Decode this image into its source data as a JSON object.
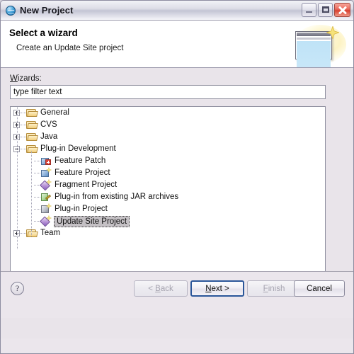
{
  "window": {
    "title": "New Project",
    "icon": "globe-icon",
    "controls": {
      "minimize": "minimize",
      "maximize": "maximize",
      "close": "close"
    }
  },
  "header": {
    "title": "Select a wizard",
    "subtitle": "Create an Update Site project",
    "banner_icon": "wizard-banner-icon"
  },
  "main": {
    "wizards_label": "Wizards:",
    "filter": {
      "value": "type filter text",
      "placeholder": "type filter text"
    },
    "tree": [
      {
        "label": "General",
        "icon": "folder-icon",
        "level": 0,
        "expandable": true,
        "expanded": false,
        "selected": false
      },
      {
        "label": "CVS",
        "icon": "folder-icon",
        "level": 0,
        "expandable": true,
        "expanded": false,
        "selected": false
      },
      {
        "label": "Java",
        "icon": "folder-icon",
        "level": 0,
        "expandable": true,
        "expanded": false,
        "selected": false
      },
      {
        "label": "Plug-in Development",
        "icon": "folder-icon",
        "level": 0,
        "expandable": true,
        "expanded": true,
        "selected": false
      },
      {
        "label": "Feature Patch",
        "icon": "feature-patch-icon",
        "level": 1,
        "expandable": false,
        "expanded": false,
        "selected": false
      },
      {
        "label": "Feature Project",
        "icon": "feature-project-icon",
        "level": 1,
        "expandable": false,
        "expanded": false,
        "selected": false
      },
      {
        "label": "Fragment Project",
        "icon": "fragment-project-icon",
        "level": 1,
        "expandable": false,
        "expanded": false,
        "selected": false
      },
      {
        "label": "Plug-in from existing JAR archives",
        "icon": "jar-plugin-icon",
        "level": 1,
        "expandable": false,
        "expanded": false,
        "selected": false
      },
      {
        "label": "Plug-in Project",
        "icon": "plugin-project-icon",
        "level": 1,
        "expandable": false,
        "expanded": false,
        "selected": false
      },
      {
        "label": "Update Site Project",
        "icon": "update-site-icon",
        "level": 1,
        "expandable": false,
        "expanded": false,
        "selected": true
      },
      {
        "label": "Team",
        "icon": "folder-icon",
        "level": 0,
        "expandable": true,
        "expanded": false,
        "selected": false
      }
    ]
  },
  "footer": {
    "help": "?",
    "buttons": {
      "back": {
        "label": "< Back",
        "prefix": "< ",
        "accel": "B",
        "rest": "ack",
        "suffix": "",
        "disabled": true,
        "default": false
      },
      "next": {
        "label": "Next >",
        "prefix": "",
        "accel": "N",
        "rest": "ext",
        "suffix": " >",
        "disabled": false,
        "default": true
      },
      "finish": {
        "label": "Finish",
        "prefix": "",
        "accel": "F",
        "rest": "inish",
        "suffix": "",
        "disabled": true,
        "default": false
      },
      "cancel": {
        "label": "Cancel",
        "prefix": "",
        "accel": "",
        "rest": "",
        "suffix": "",
        "disabled": false,
        "default": false
      }
    }
  },
  "colors": {
    "dialog_bg": "#ebe6ec",
    "header_bg": "#ffffff",
    "selection_bg": "#c4c0c4",
    "default_button_border": "#2a5699",
    "close_button": "#d9402f"
  }
}
